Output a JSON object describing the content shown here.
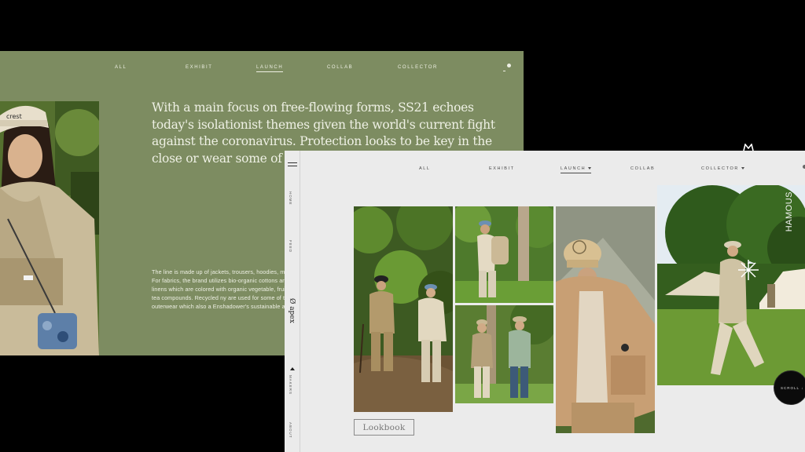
{
  "back_window": {
    "nav": [
      "ALL",
      "EXHIBIT",
      "LAUNCH",
      "COLLAB",
      "COLLECTOR"
    ],
    "active_nav": "LAUNCH",
    "headline": "With a main focus on free-flowing forms, SS21 echoes today's isolationist themes given the world's current fight against the coronavirus. Protection looks to be key in the close or wear some of",
    "body_copy": "The line is made up of jackets, trousers, hoodies, more. For fabrics, the brand utilizes bio-organic cottons and linens which are colored with organic vegetable, fruit, and tea compounds. Recycled ny are used for some of the outerwear which also a Enshadower's sustainable appeal.",
    "cap_text": "crest"
  },
  "front_window": {
    "sidebar": {
      "items": [
        "HOME",
        "FEED",
        "MAKERS",
        "ABOUT"
      ],
      "logo": "Ø apex"
    },
    "nav": [
      {
        "label": "ALL"
      },
      {
        "label": "EXHIBIT"
      },
      {
        "label": "LAUNCH",
        "dropdown": true
      },
      {
        "label": "COLLAB"
      },
      {
        "label": "COLLECTOR",
        "dropdown": true
      }
    ],
    "active_nav": "LAUNCH",
    "lookbook_label": "Lookbook",
    "side_caption": "HAMOUS"
  },
  "scroll_badge": "SCROLL ↓"
}
